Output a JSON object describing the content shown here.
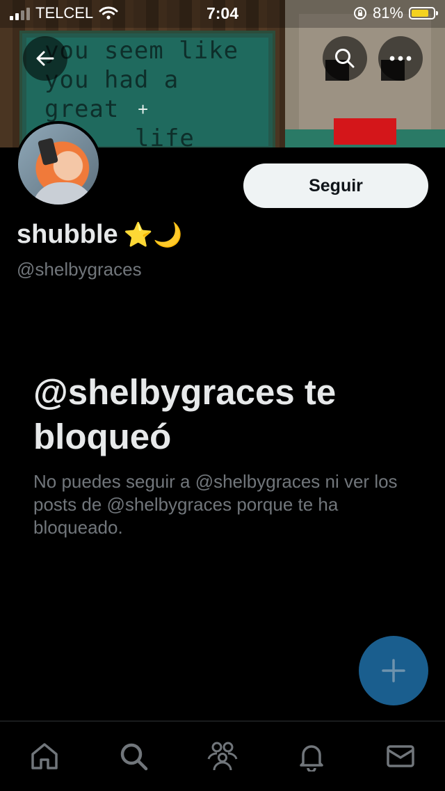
{
  "status_bar": {
    "carrier": "TELCEL",
    "time": "7:04",
    "battery_percent": "81%",
    "battery_level": 0.81,
    "battery_color": "#f4d21f"
  },
  "header_banner": {
    "sign_lines": [
      "you seem like",
      "you had a great",
      "life"
    ]
  },
  "header_buttons": {
    "back_icon": "arrow-left-icon",
    "search_icon": "search-icon",
    "more_icon": "more-horizontal-icon"
  },
  "profile": {
    "display_name": "shubble",
    "display_name_emoji": "⭐🌙",
    "handle": "@shelbygraces",
    "follow_label": "Seguir"
  },
  "blocked": {
    "title": "@shelbygraces te bloqueó",
    "description": "No puedes seguir a @shelbygraces ni ver los posts de @shelbygraces porque te ha bloqueado."
  },
  "fab": {
    "icon": "plus-icon",
    "color": "#1a5e8e"
  },
  "tab_bar": {
    "tabs": [
      {
        "name": "home",
        "icon": "home-icon"
      },
      {
        "name": "explore",
        "icon": "search-icon"
      },
      {
        "name": "communities",
        "icon": "people-icon"
      },
      {
        "name": "notifications",
        "icon": "bell-icon"
      },
      {
        "name": "messages",
        "icon": "mail-icon"
      }
    ]
  },
  "colors": {
    "background": "#000000",
    "primary_text": "#e7e9ea",
    "secondary_text": "#71767b",
    "button_bg": "#eff3f4"
  }
}
